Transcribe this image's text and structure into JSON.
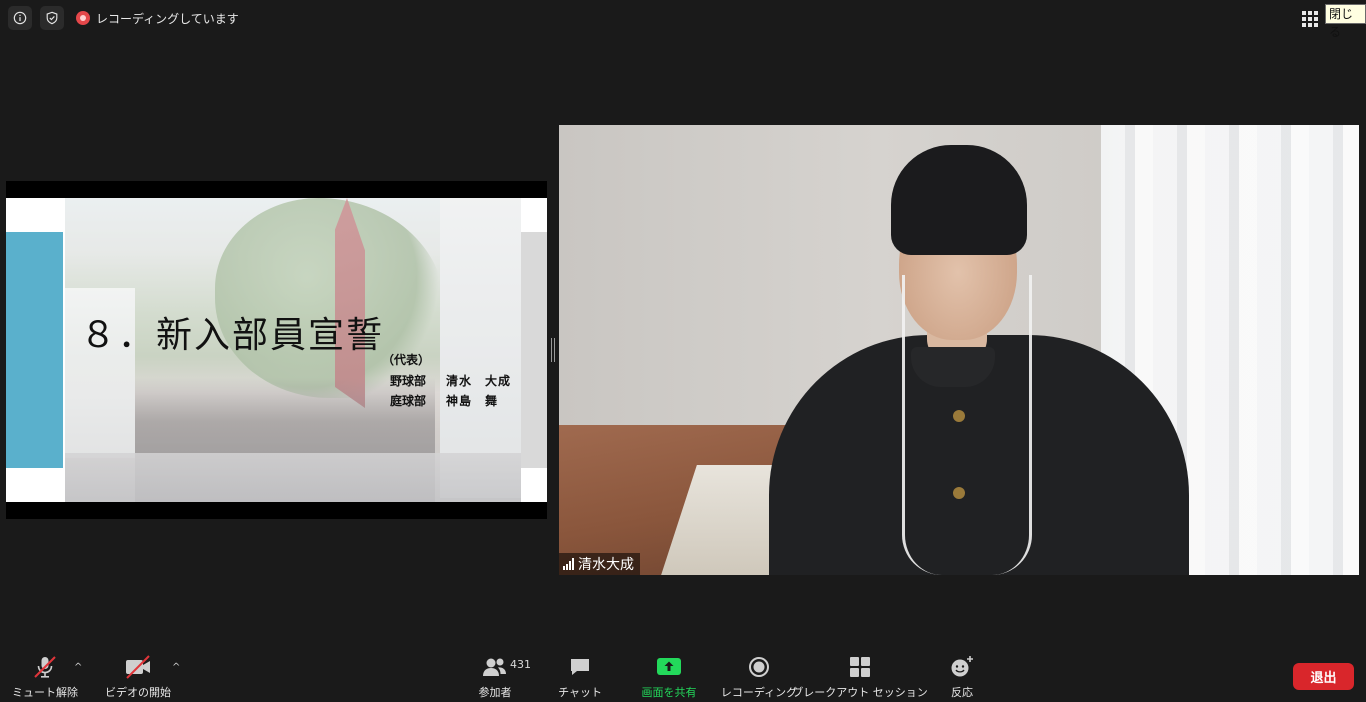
{
  "topbar": {
    "recording_text": "レコーディングしています",
    "tooltip": "閉じる"
  },
  "shared_slide": {
    "title": "８．新入部員宣誓",
    "representative_label": "（代表）",
    "rows": [
      {
        "club": "野球部",
        "name": "清水　大成"
      },
      {
        "club": "庭球部",
        "name": "神島　舞"
      }
    ]
  },
  "video": {
    "participant_name": "清水大成"
  },
  "toolbar": {
    "unmute_label": "ミュート解除",
    "start_video_label": "ビデオの開始",
    "participants_label": "参加者",
    "participants_count": "431",
    "chat_label": "チャット",
    "share_label": "画面を共有",
    "record_label": "レコーディング",
    "breakout_label": "ブレークアウト セッション",
    "reactions_label": "反応",
    "leave_label": "退出"
  },
  "colors": {
    "background": "#1a1a1a",
    "share_accent": "#23d95b",
    "leave_button": "#d9262b",
    "mute_slash": "#e0353a",
    "slide_accent": "#5ab0cc"
  },
  "icons": [
    "info-icon",
    "shield-icon",
    "recording-icon",
    "gallery-grid-icon",
    "microphone-muted-icon",
    "video-off-icon",
    "participants-icon",
    "chat-icon",
    "share-screen-icon",
    "record-icon",
    "breakout-rooms-icon",
    "reaction-icon",
    "signal-icon"
  ]
}
